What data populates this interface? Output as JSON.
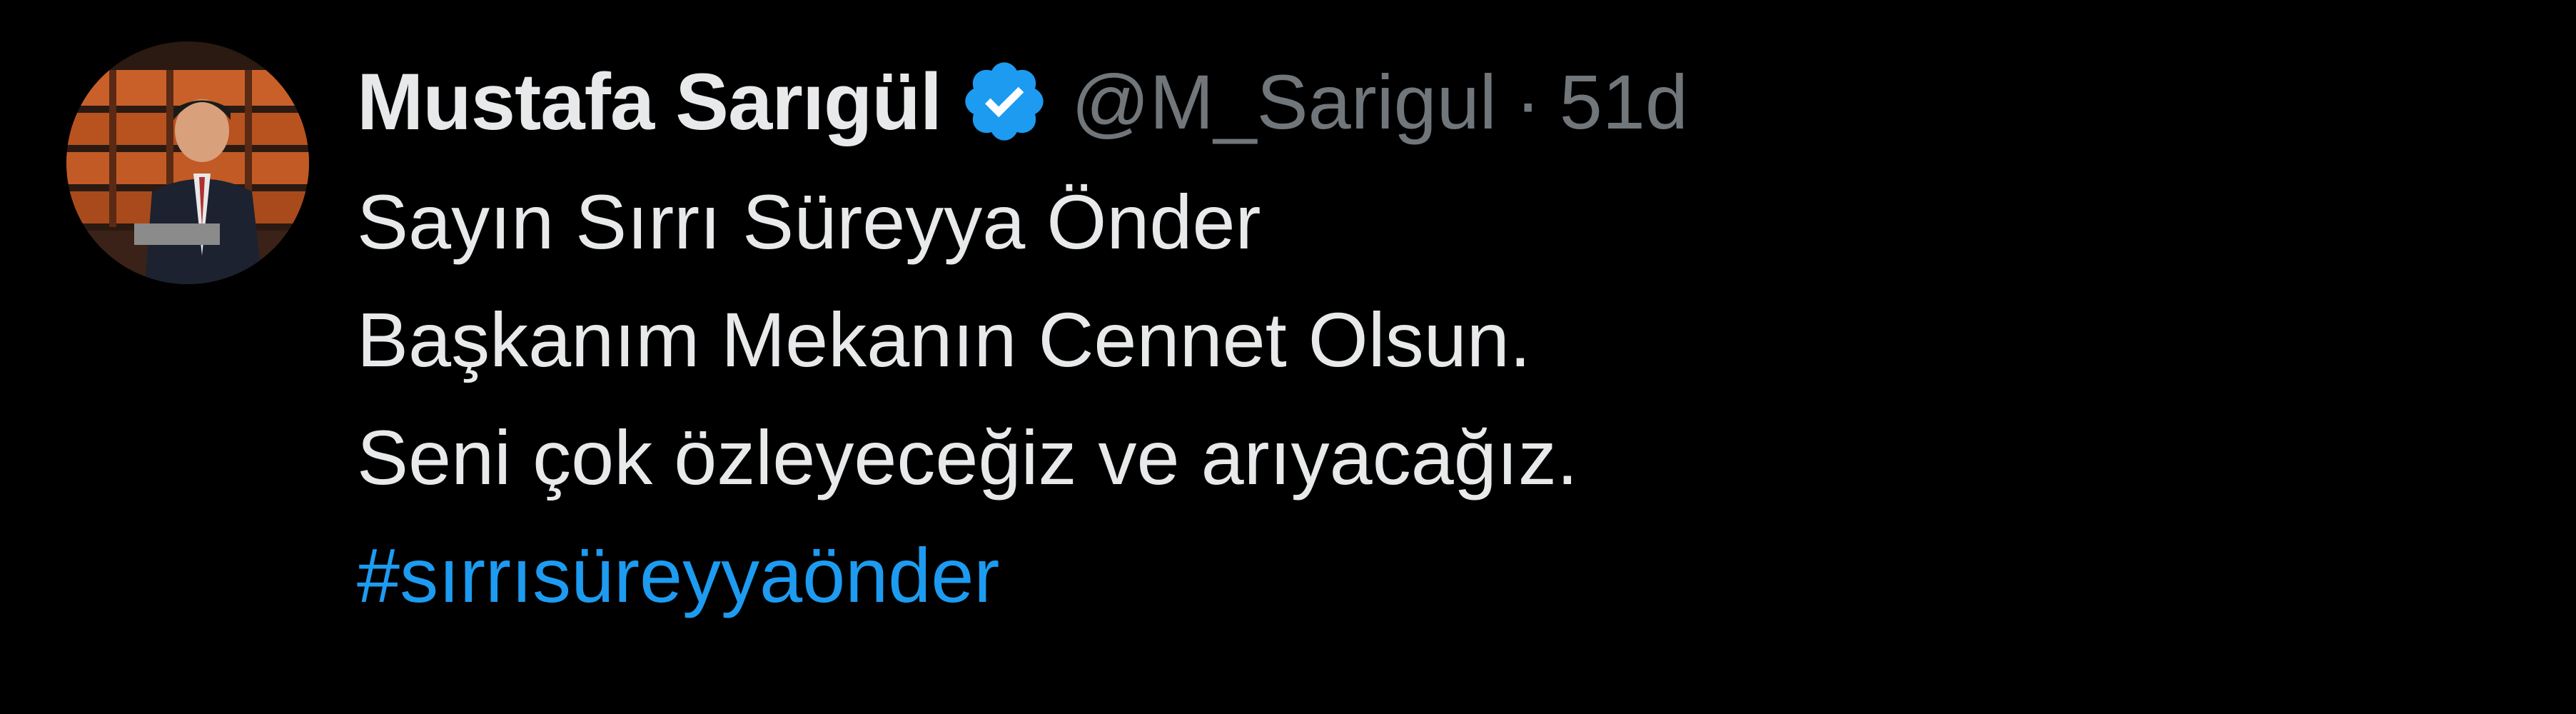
{
  "tweet": {
    "author": {
      "display_name": "Mustafa Sarıgül",
      "handle": "@M_Sarigul",
      "verified_icon": "verified-badge-icon",
      "avatar_icon": "profile-photo"
    },
    "separator": "·",
    "timestamp": "51d",
    "text_lines": [
      "Sayın Sırrı Süreyya Önder",
      "Başkanım Mekanın Cennet Olsun.",
      "Seni çok özleyeceğiz ve arıyacağız."
    ],
    "hashtag": "#sırrısüreyyaönder"
  },
  "colors": {
    "background": "#000000",
    "primary_text": "#e7e9ea",
    "secondary_text": "#71767b",
    "link": "#1d9bf0",
    "verified_badge": "#1d9bf0"
  }
}
